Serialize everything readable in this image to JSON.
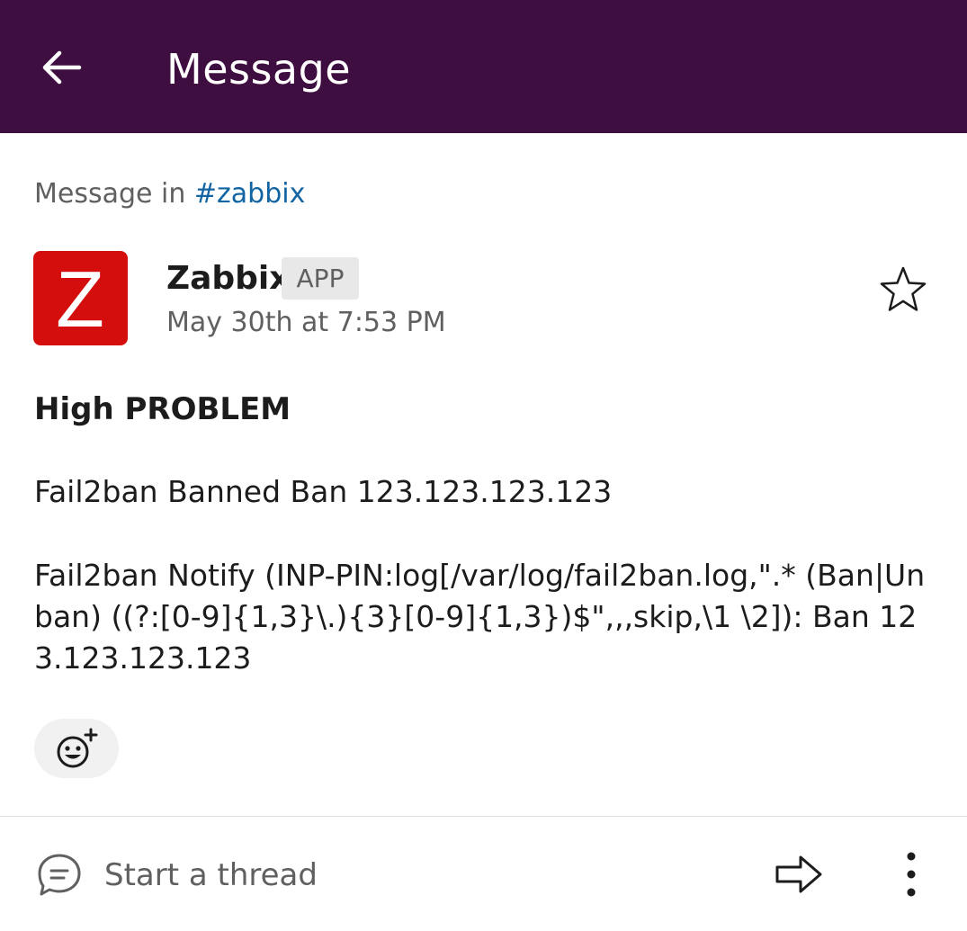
{
  "header": {
    "title": "Message",
    "back_icon": "arrow-left-icon"
  },
  "context": {
    "prefix": "Message in ",
    "channel": "#zabbix"
  },
  "message": {
    "sender": "Zabbix",
    "badge": "APP",
    "timestamp": "May 30th at 7:53 PM",
    "avatar_icon": "zabbix-logo-icon",
    "avatar_letter": "Z",
    "heading": "High PROBLEM",
    "line1": "Fail2ban Banned Ban 123.123.123.123",
    "line2": "Fail2ban Notify (INP-PIN:log[/var/log/fail2ban.log,\".* (Ban|Unban) ((?:[0-9]{1,3}\\.){3}[0-9]{1,3})$\",,,skip,\\1 \\2]): Ban 123.123.123.123"
  },
  "actions": {
    "star_icon": "star-icon",
    "add_reaction_icon": "add-reaction-icon"
  },
  "footer": {
    "thread_label": "Start a thread",
    "thread_icon": "speech-bubble-icon",
    "share_icon": "share-arrow-icon",
    "more_icon": "more-vertical-icon"
  },
  "colors": {
    "header_bg": "#3f0e40",
    "link": "#1264a3",
    "avatar_bg": "#d40e0d"
  }
}
